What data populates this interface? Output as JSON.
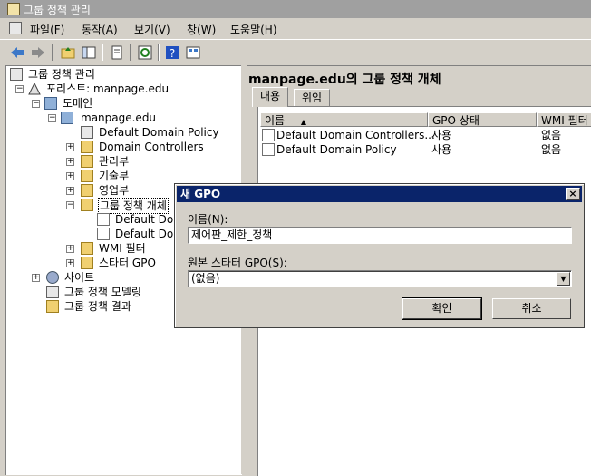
{
  "window": {
    "title": "그룹 정책 관리"
  },
  "menu": [
    "파일(F)",
    "동작(A)",
    "보기(V)",
    "창(W)",
    "도움말(H)"
  ],
  "toolbar": {
    "icons": [
      "back-arrow-icon",
      "forward-arrow-icon",
      "up-folder-icon",
      "show-hide-tree-icon",
      "properties-icon",
      "refresh-icon",
      "help-icon",
      "export-list-icon"
    ]
  },
  "tree": {
    "root": "그룹 정책 관리",
    "forest": "포리스트: manpage.edu",
    "domains": "도메인",
    "domain": "manpage.edu",
    "default_domain_policy": "Default Domain Policy",
    "domain_controllers": "Domain Controllers",
    "ou1": "관리부",
    "ou2": "기술부",
    "ou3": "영업부",
    "gpo_container": "그룹 정책 개체",
    "gpo_child1": "Default Dom",
    "gpo_child2": "Default Dom",
    "wmi_filters": "WMI 필터",
    "starter_gpo": "스타터 GPO",
    "sites": "사이트",
    "modeling": "그룹 정책 모델링",
    "results": "그룹 정책 결과"
  },
  "right": {
    "title": "manpage.edu의 그룹 정책 개체",
    "tabs": [
      "내용",
      "위임"
    ],
    "columns": [
      "이름",
      "GPO 상태",
      "WMI 필터"
    ],
    "rows": [
      {
        "name": "Default Domain Controllers...",
        "status": "사용",
        "wmi": "없음"
      },
      {
        "name": "Default Domain Policy",
        "status": "사용",
        "wmi": "없음"
      }
    ]
  },
  "dialog": {
    "title": "새 GPO",
    "close": "×",
    "name_label": "이름(N):",
    "name_value": "제어판_제한_정책",
    "source_label": "원본 스타터 GPO(S):",
    "source_value": "(없음)",
    "ok": "확인",
    "cancel": "취소"
  },
  "colors": {
    "dialog_title_bg": "#0a246a",
    "face": "#d4d0c8"
  }
}
